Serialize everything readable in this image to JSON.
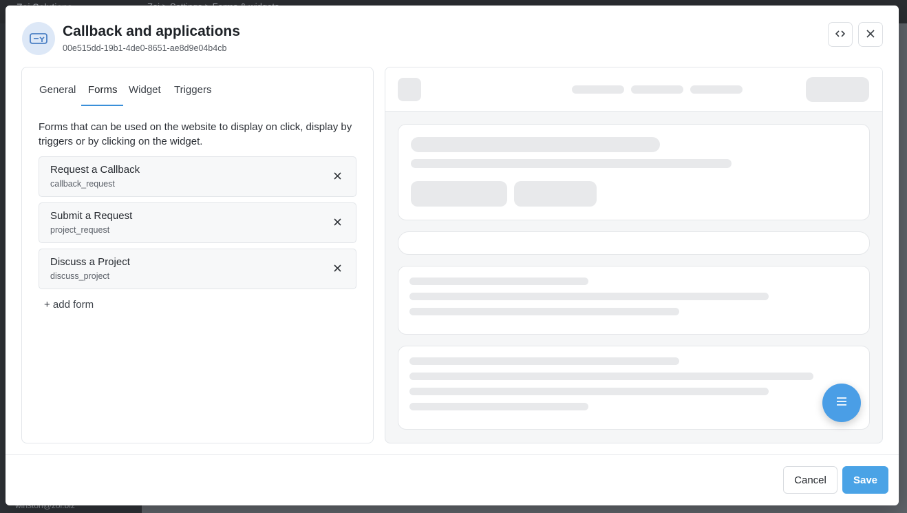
{
  "backdrop": {
    "app_name": "Zoi Solutions",
    "breadcrumb": "Zoi  >  Settings  >  Forms & widgets",
    "user_email": "winston@zoi.biz"
  },
  "modal": {
    "title": "Callback and applications",
    "id": "00e515dd-19b1-4de0-8651-ae8d9e04b4cb",
    "tabs": [
      {
        "label": "General"
      },
      {
        "label": "Forms"
      },
      {
        "label": "Widget"
      },
      {
        "label": "Triggers"
      }
    ],
    "active_tab": "Forms",
    "description": "Forms that can be used on the website to display on click, display by triggers or by clicking on the widget.",
    "forms": [
      {
        "name": "Request a Callback",
        "key": "callback_request"
      },
      {
        "name": "Submit a Request",
        "key": "project_request"
      },
      {
        "name": "Discuss a Project",
        "key": "discuss_project"
      }
    ],
    "add_form_label": "+ add form",
    "cancel_label": "Cancel",
    "save_label": "Save"
  },
  "colors": {
    "accent": "#3a8fd9",
    "save_button": "#4aa3e6",
    "fab": "#4a9ee6"
  },
  "icons": {
    "header": "widget-link-icon",
    "code": "code-icon",
    "close": "close-icon",
    "remove": "close-icon",
    "fab": "menu-icon"
  }
}
